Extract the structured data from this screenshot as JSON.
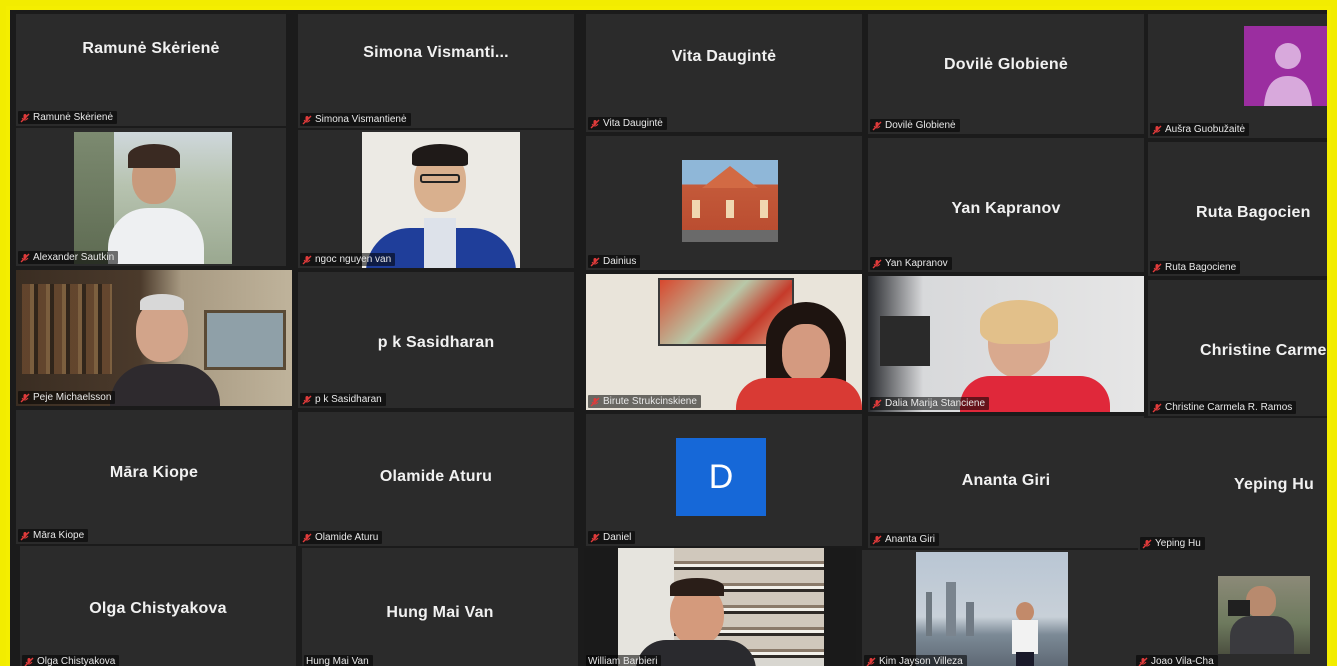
{
  "meeting": {
    "row1": [
      {
        "name": "Ramunė Skėrienė",
        "label": "Ramunė Skėrienė"
      },
      {
        "name": "Simona  Vismanti...",
        "label": "Simona Vismantienė"
      },
      {
        "name": "Vita Daugintė",
        "label": "Vita Daugintė"
      },
      {
        "name": "Dovilė Globienė",
        "label": "Dovilė Globienė"
      },
      {
        "name": "",
        "label": "Aušra Guobužaitė"
      }
    ],
    "row2": [
      {
        "name": "",
        "label": "Alexander Sautkin"
      },
      {
        "name": "",
        "label": "ngoc nguyen van"
      },
      {
        "name": "",
        "label": "Dainius"
      },
      {
        "name": "Yan Kapranov",
        "label": "Yan Kapranov"
      },
      {
        "name": "Ruta Bagocien",
        "label": "Ruta Bagociene"
      }
    ],
    "row3": [
      {
        "name": "",
        "label": "Peje Michaelsson"
      },
      {
        "name": "p k Sasidharan",
        "label": "p k Sasidharan"
      },
      {
        "name": "",
        "label": "Birute Strukcinskiene"
      },
      {
        "name": "",
        "label": "Dalia Marija Stanciene"
      },
      {
        "name": "Christine  Carme",
        "label": "Christine Carmela R. Ramos"
      }
    ],
    "row4": [
      {
        "name": "Māra Kiope",
        "label": "Māra Kiope"
      },
      {
        "name": "Olamide Aturu",
        "label": "Olamide Aturu"
      },
      {
        "name": "D",
        "label": "Daniel"
      },
      {
        "name": "Ananta Giri",
        "label": "Ananta Giri"
      },
      {
        "name": "Yeping Hu",
        "label": "Yeping Hu"
      }
    ],
    "row5": [
      {
        "name": "Olga Chistyakova",
        "label": "Olga Chistyakova"
      },
      {
        "name": "Hung Mai Van",
        "label": "Hung Mai Van"
      },
      {
        "name": "",
        "label": "William Barbieri"
      },
      {
        "name": "",
        "label": "Kim Jayson Villeza"
      },
      {
        "name": "",
        "label": "Joao Vila-Cha"
      }
    ]
  },
  "colors": {
    "border": "#f4ee00",
    "tile": "#2b2b2b",
    "muted_mic": "#e03b3b",
    "avatar": "#9b2ea0",
    "initial_tile": "#1668d8"
  }
}
